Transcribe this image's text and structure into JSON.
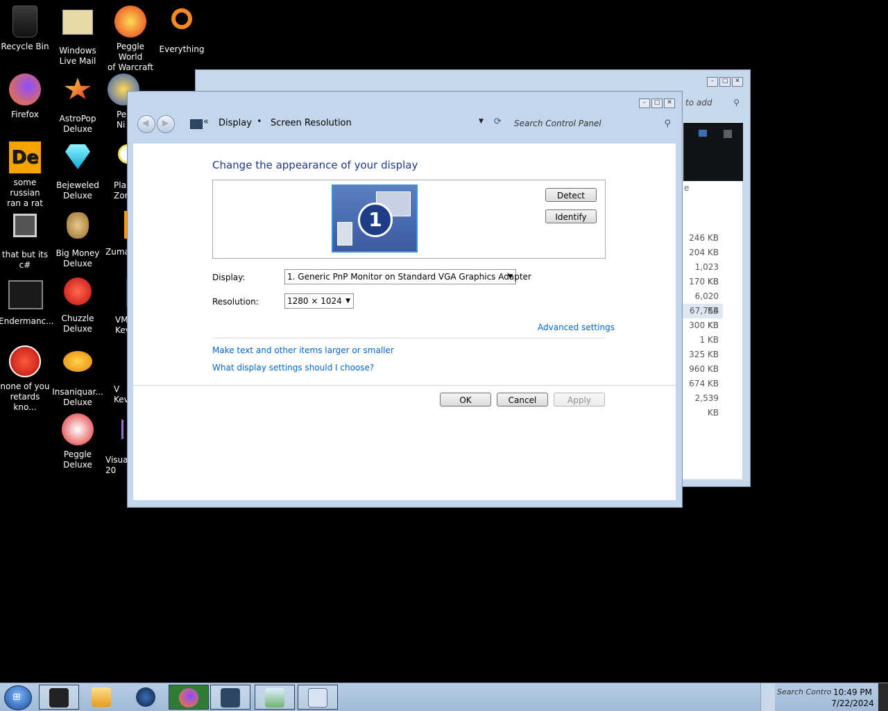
{
  "desktop": {
    "icons": [
      {
        "label": "Recycle Bin"
      },
      {
        "label": "Windows\nLive Mail"
      },
      {
        "label": "Peggle World\nof Warcraft ..."
      },
      {
        "label": "Everything"
      },
      {
        "label": "Firefox"
      },
      {
        "label": "AstroPop\nDeluxe"
      },
      {
        "label": "Pe\nNi"
      },
      {
        "label": "some russian\nran a rat"
      },
      {
        "label": "Bejeweled\nDeluxe"
      },
      {
        "label": "Plan\nZor"
      },
      {
        "label": "that but its\nc#"
      },
      {
        "label": "Big Money\nDeluxe"
      },
      {
        "label": "Zuma"
      },
      {
        "label": "Endermanc..."
      },
      {
        "label": "Chuzzle\nDeluxe"
      },
      {
        "label": "VM\nKev"
      },
      {
        "label": "none of you\nretards kno..."
      },
      {
        "label": "Insaniquar...\nDeluxe"
      },
      {
        "label": "V\nKev"
      },
      {
        "label": "Peggle\nDeluxe"
      },
      {
        "label": "Visual\n20"
      }
    ]
  },
  "background_window": {
    "search_placeholder": "to add",
    "sizes": [
      "246 KB",
      "204 KB",
      "1,023 KB",
      "170 KB",
      "6,020 KB",
      "67,754 KB",
      "300 KB",
      "1 KB",
      "325 KB",
      "960 KB",
      "674 KB",
      "2,539 KB"
    ],
    "col_fragment": "e"
  },
  "dialog": {
    "breadcrumb": {
      "chevron": "«",
      "item1": "Display",
      "sep": "•",
      "item2": "Screen Resolution"
    },
    "search_placeholder": "Search Control Panel",
    "heading": "Change the appearance of your display",
    "monitor_number": "1",
    "detect_label": "Detect",
    "identify_label": "Identify",
    "display_label": "Display:",
    "display_value": "1. Generic PnP Monitor on Standard VGA Graphics Adapter",
    "resolution_label": "Resolution:",
    "resolution_value": "1280 × 1024",
    "advanced_link": "Advanced settings",
    "link_text_size": "Make text and other items larger or smaller",
    "link_which_settings": "What display settings should I choose?",
    "ok_label": "OK",
    "cancel_label": "Cancel",
    "apply_label": "Apply"
  },
  "taskbar": {
    "tray_search": "Search Contro",
    "time": "10:49 PM",
    "date": "7/22/2024"
  },
  "colors": {
    "heading": "#1e3a87",
    "link": "#0066cc",
    "dialog_chrome": "#c4d6ec"
  }
}
